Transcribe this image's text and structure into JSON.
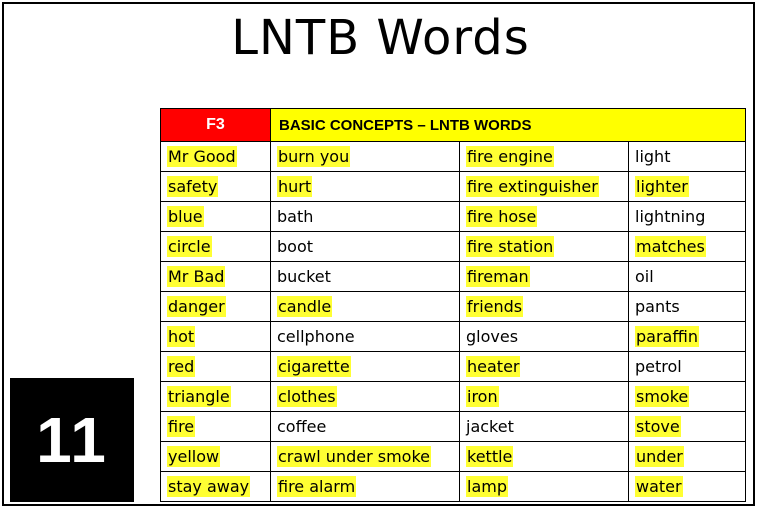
{
  "title": "LNTB Words",
  "badge": "11",
  "colors": {
    "highlight": "#ffff33",
    "header_code_bg": "#ff0000",
    "header_title_bg": "#ffff00"
  },
  "table": {
    "code": "F3",
    "heading": "BASIC CONCEPTS – LNTB WORDS",
    "rows": [
      [
        {
          "t": "Mr Good",
          "h": true
        },
        {
          "t": "burn you",
          "h": true
        },
        {
          "t": "fire engine",
          "h": true
        },
        {
          "t": "light",
          "h": false
        }
      ],
      [
        {
          "t": "safety",
          "h": true
        },
        {
          "t": "hurt",
          "h": true
        },
        {
          "t": "fire extinguisher",
          "h": true
        },
        {
          "t": "lighter",
          "h": true
        }
      ],
      [
        {
          "t": "blue",
          "h": true
        },
        {
          "t": "bath",
          "h": false
        },
        {
          "t": "fire hose",
          "h": true
        },
        {
          "t": "lightning",
          "h": false
        }
      ],
      [
        {
          "t": "circle",
          "h": true
        },
        {
          "t": "boot",
          "h": false
        },
        {
          "t": "fire station",
          "h": true
        },
        {
          "t": "matches",
          "h": true
        }
      ],
      [
        {
          "t": "Mr Bad",
          "h": true
        },
        {
          "t": "bucket",
          "h": false
        },
        {
          "t": "fireman",
          "h": true
        },
        {
          "t": "oil",
          "h": false
        }
      ],
      [
        {
          "t": "danger",
          "h": true
        },
        {
          "t": "candle",
          "h": true
        },
        {
          "t": "friends",
          "h": true
        },
        {
          "t": "pants",
          "h": false
        }
      ],
      [
        {
          "t": "hot",
          "h": true
        },
        {
          "t": "cellphone",
          "h": false
        },
        {
          "t": "gloves",
          "h": false
        },
        {
          "t": "paraffin",
          "h": true
        }
      ],
      [
        {
          "t": "red",
          "h": true
        },
        {
          "t": "cigarette",
          "h": true
        },
        {
          "t": "heater",
          "h": true
        },
        {
          "t": "petrol",
          "h": false
        }
      ],
      [
        {
          "t": "triangle",
          "h": true
        },
        {
          "t": "clothes",
          "h": true
        },
        {
          "t": "iron",
          "h": true
        },
        {
          "t": "smoke",
          "h": true
        }
      ],
      [
        {
          "t": "fire",
          "h": true
        },
        {
          "t": "coffee",
          "h": false
        },
        {
          "t": "jacket",
          "h": false
        },
        {
          "t": "stove",
          "h": true
        }
      ],
      [
        {
          "t": "yellow",
          "h": true
        },
        {
          "t": "crawl under smoke",
          "h": true
        },
        {
          "t": "kettle",
          "h": true
        },
        {
          "t": "under",
          "h": true
        }
      ],
      [
        {
          "t": "stay away",
          "h": true
        },
        {
          "t": "fire alarm",
          "h": true
        },
        {
          "t": "lamp",
          "h": true
        },
        {
          "t": "water",
          "h": true
        }
      ]
    ]
  }
}
